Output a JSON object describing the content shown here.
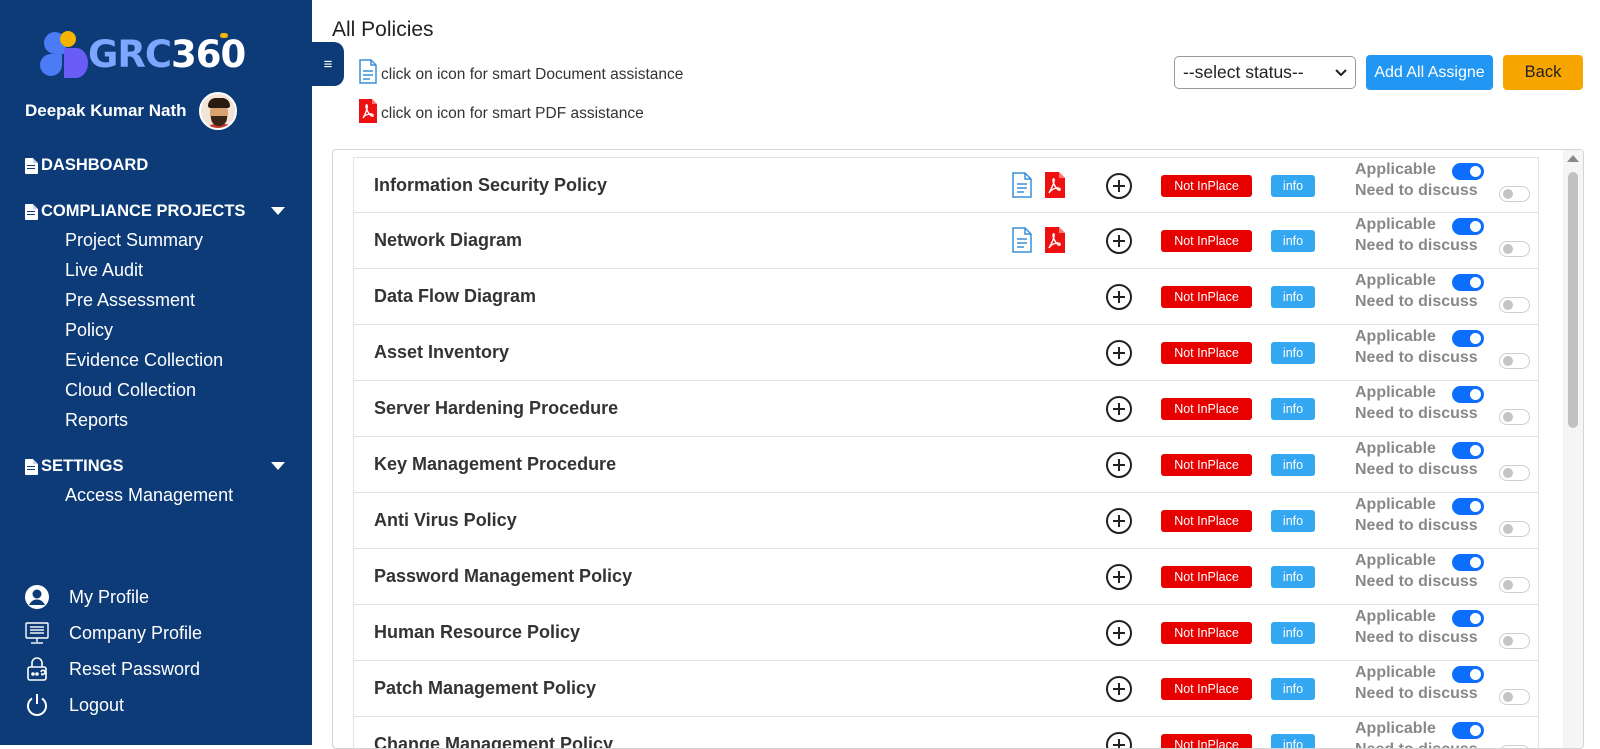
{
  "brand": {
    "grc": "GRC",
    "num": "360"
  },
  "user": {
    "name": "Deepak Kumar Nath"
  },
  "nav": {
    "dashboard": "DASHBOARD",
    "compliance": "COMPLIANCE PROJECTS",
    "compliance_items": [
      "Project Summary",
      "Live Audit",
      "Pre Assessment",
      "Policy",
      "Evidence Collection",
      "Cloud Collection",
      "Reports"
    ],
    "settings": "SETTINGS",
    "settings_items": [
      "Access Management"
    ]
  },
  "bottom_nav": [
    "My Profile",
    "Company Profile",
    "Reset Password",
    "Logout"
  ],
  "toggle_glyph": "≡",
  "page": {
    "title": "All Policies",
    "hint_doc": "click on icon for smart Document assistance",
    "hint_pdf": "click on icon for smart PDF assistance"
  },
  "toolbar": {
    "select_value": "--select status--",
    "add_assign_label": "Add All Assigne",
    "back_label": "Back"
  },
  "row_labels": {
    "status": "Not InPlace",
    "info": "info",
    "applicable": "Applicable",
    "need": "Need to discuss"
  },
  "policies": [
    {
      "name": "Information Security Policy",
      "has_docs": true
    },
    {
      "name": "Network Diagram",
      "has_docs": true
    },
    {
      "name": "Data Flow Diagram",
      "has_docs": false
    },
    {
      "name": "Asset Inventory",
      "has_docs": false
    },
    {
      "name": "Server Hardening Procedure",
      "has_docs": false
    },
    {
      "name": "Key Management Procedure",
      "has_docs": false
    },
    {
      "name": "Anti Virus Policy",
      "has_docs": false
    },
    {
      "name": "Password Management Policy",
      "has_docs": false
    },
    {
      "name": "Human Resource Policy",
      "has_docs": false
    },
    {
      "name": "Patch Management Policy",
      "has_docs": false
    },
    {
      "name": "Change Management Policy",
      "has_docs": false
    }
  ],
  "colors": {
    "sidebar": "#0d3b78",
    "status_red": "#e60000",
    "info_blue": "#33a7ef",
    "primary": "#2196f3",
    "back": "#f7a600"
  }
}
